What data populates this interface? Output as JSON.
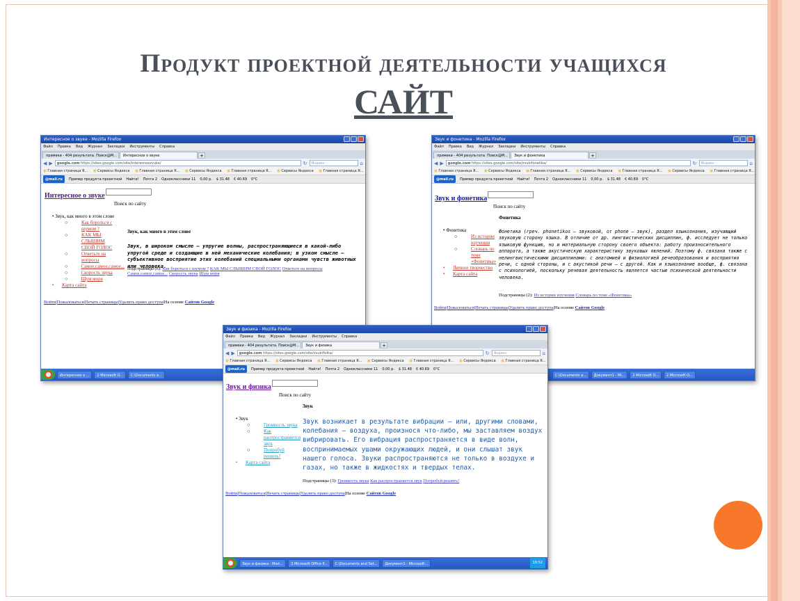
{
  "slide": {
    "title_line1": "Продукт проектной деятельности учащихся",
    "title_line2": "САЙТ"
  },
  "browser": {
    "menu": [
      "Файл",
      "Правка",
      "Вид",
      "Журнал",
      "Закладки",
      "Инструменты",
      "Справка"
    ],
    "tab_first": "примеки - 404 результата. Поиск@M...",
    "url_prefix": "google.com",
    "search_placeholder": "Яндекс",
    "bookmarks": [
      "Главная страница Я...",
      "Сервисы Яндекса",
      "Главная страница Я...",
      "Сервисы Яндекса",
      "Главная страница Я...",
      "Сервисы Яндекса",
      "Главная страница Я..."
    ],
    "mail_logo": "@mail.ru",
    "toolbar_project": "Пример продукта проектной",
    "toolbar_find": "Найти!",
    "toolbar_mail": "Почта 2",
    "toolbar_ok": "Одноклассники 11",
    "toolbar_money": "0,00 р.",
    "toolbar_usd": "$ 31.48",
    "toolbar_eur": "€ 40.69",
    "toolbar_temp": "0°C",
    "start_icon": "windows-start-icon"
  },
  "win1": {
    "title": "Интересное о звуке - Mozilla Firefox",
    "tab_active": "Интересное о звуке",
    "url": "https://sites.google.com/site/interesnoezvuke/",
    "site_title": "Интересное о звуке",
    "search_label": "Поиск по сайту",
    "nav_top": "Звук, как много в этом слове",
    "nav_sub": [
      "Как бороться с шумом ?",
      "КАК МЫ СЛЫШИМ СВОЙ ГОЛОС",
      "Ответьте на вопросы",
      "Самое,самое,самое...",
      "Скорость звука",
      "Шум моря"
    ],
    "nav_map": "Карта сайта",
    "page_title": "Звук, как много в этом слове",
    "article": "Звук, в широком смысле — упругие волны, распространяющиеся в какой-либо упругой среде и создающие в ней механические колебания; в узком смысле — субъективное восприятие этих колебаний специальными органами чувств животных или человека.",
    "subpages_label": "Подстраницы (6):",
    "subpages": [
      "Как бороться с шумом ?",
      "КАК МЫ СЛЫШИМ СВОЙ ГОЛОС",
      "Ответьте на вопросы",
      "Самое,самое,самое...",
      "Скорость звука",
      "Шум моря"
    ],
    "footer_links": [
      "Войти",
      "Пожаловаться",
      "Печать страницы",
      "Удалить право доступа"
    ],
    "footer_based": "На основе",
    "footer_brand": "Сайтов Google",
    "taskbar": [
      "Интересное о ...",
      "2 Microsoft O...",
      "C:\\Documents a..."
    ]
  },
  "win2": {
    "title": "Звук и фонетика - Mozilla Firefox",
    "tab_active": "Звук и фонетика",
    "url": "https://sites.google.com/site/zvukifonetika/",
    "site_title": "Звук и фонетика",
    "search_label": "Поиск по сайту",
    "nav_top": "Фонетика",
    "nav_sub": [
      "Из истории изучения",
      "Словарь по теме «Фонетика»"
    ],
    "nav_extra": [
      "Личное творчество",
      "Карта сайта"
    ],
    "page_title": "Фонетика",
    "article": "Фонетика (греч. phonetikos – звуковой, от phone – звук), раздел языкознания, изучающий звуковую сторону языка. В отличие от др. лингвистических дисциплин, ф. исследует не только языковую функцию, но и материальную сторону своего объекта: работу произносительного аппарата, а также акустическую характеристику звуковых явлений. Поэтому ф. связана также с нелингвистическими дисциплинами: с анатомией и физиологией речеобразования и восприятия речи, с одной стороны, и с акустикой речи – с другой. Как и языкознание вообще, ф. связана с психологией, поскольку речевая деятельность является частью психической деятельности человека.",
    "subpages_label": "Подстраницы (2):",
    "subpages": [
      "Из истории изучения",
      "Словарь по теме «Фонетика»"
    ],
    "footer_links": [
      "Войти",
      "Пожаловаться",
      "Печать страницы",
      "Удалить право доступа"
    ],
    "footer_based": "На основе",
    "footer_brand": "Сайтов Google",
    "taskbar": [
      "C:\\Documents a...",
      "Документ1 - Mi...",
      "2 Microsoft O...",
      "2 Microsoft O..."
    ]
  },
  "win3": {
    "title": "Звук и физика - Mozilla Firefox",
    "tab_active": "Звук и физика",
    "url": "https://sites.google.com/site/zvukifizika/",
    "site_title": "Звук и физика",
    "search_label": "Поиск по сайту",
    "nav_top": "Звук",
    "nav_sub": [
      "Громкость звука",
      "Как распространяется звук",
      "Попробуй решить!"
    ],
    "nav_map": "Карта сайта",
    "page_title": "Звук",
    "article": "Звук возникает в результате вибрации — или, другими словами, колебания — воздуха, произнося что-либо, мы заставляем воздух вибрировать. Его вибрация распространяется в виде волн, воспринимаемых ушами окружающих людей, и они слышат звук нашего голоса. Звуки распространяются не только в воздухе и газах, но также в жидкостях и твердых телах.",
    "subpages_label": "Подстраницы (3):",
    "subpages": [
      "Громкость звука",
      "Как распространяется звук",
      "Попробуй решить!"
    ],
    "footer_links": [
      "Войти",
      "Пожаловаться",
      "Печать страницы",
      "Удалить право доступа"
    ],
    "footer_based": "На основе",
    "footer_brand": "Сайтов Google",
    "taskbar": [
      "Звук и физика - Mozi...",
      "2 Microsoft Office P...",
      "C:\\Documents and Set...",
      "Документ1 - Microsoft..."
    ],
    "clock": "19:52"
  }
}
